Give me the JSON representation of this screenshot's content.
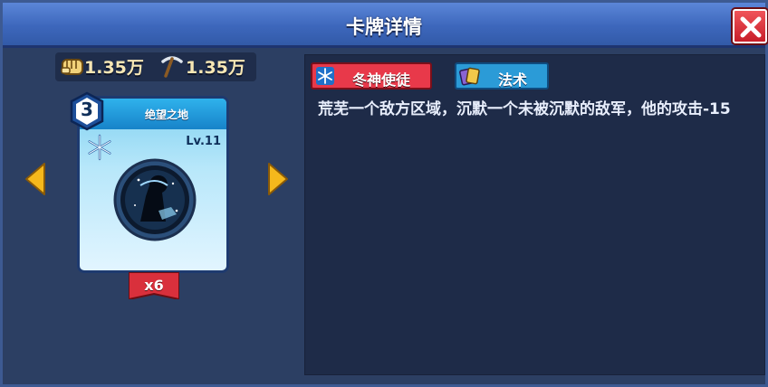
{
  "dialog": {
    "title": "卡牌详情",
    "close_icon": "close-icon"
  },
  "resources": {
    "power": {
      "icon": "fist-icon",
      "value": "1.35万"
    },
    "mining": {
      "icon": "pickaxe-icon",
      "value": "1.35万"
    }
  },
  "card": {
    "name": "绝望之地",
    "cost": "3",
    "level": "Lv.11",
    "element_icon": "snowflake-icon",
    "count": "x6"
  },
  "navigation": {
    "prev_icon": "arrow-left-icon",
    "next_icon": "arrow-right-icon"
  },
  "detail": {
    "faction_tag": "冬神使徒",
    "type_tag": "法术",
    "description": "荒芜一个敌方区域，沉默一个未被沉默的敌军，他的攻击-15"
  },
  "colors": {
    "title_bar": "#3d67bc",
    "panel": "#1e2b48",
    "faction_tag": "#e8394a",
    "type_tag": "#2b9bd7",
    "arrow": "#f5b81c"
  }
}
